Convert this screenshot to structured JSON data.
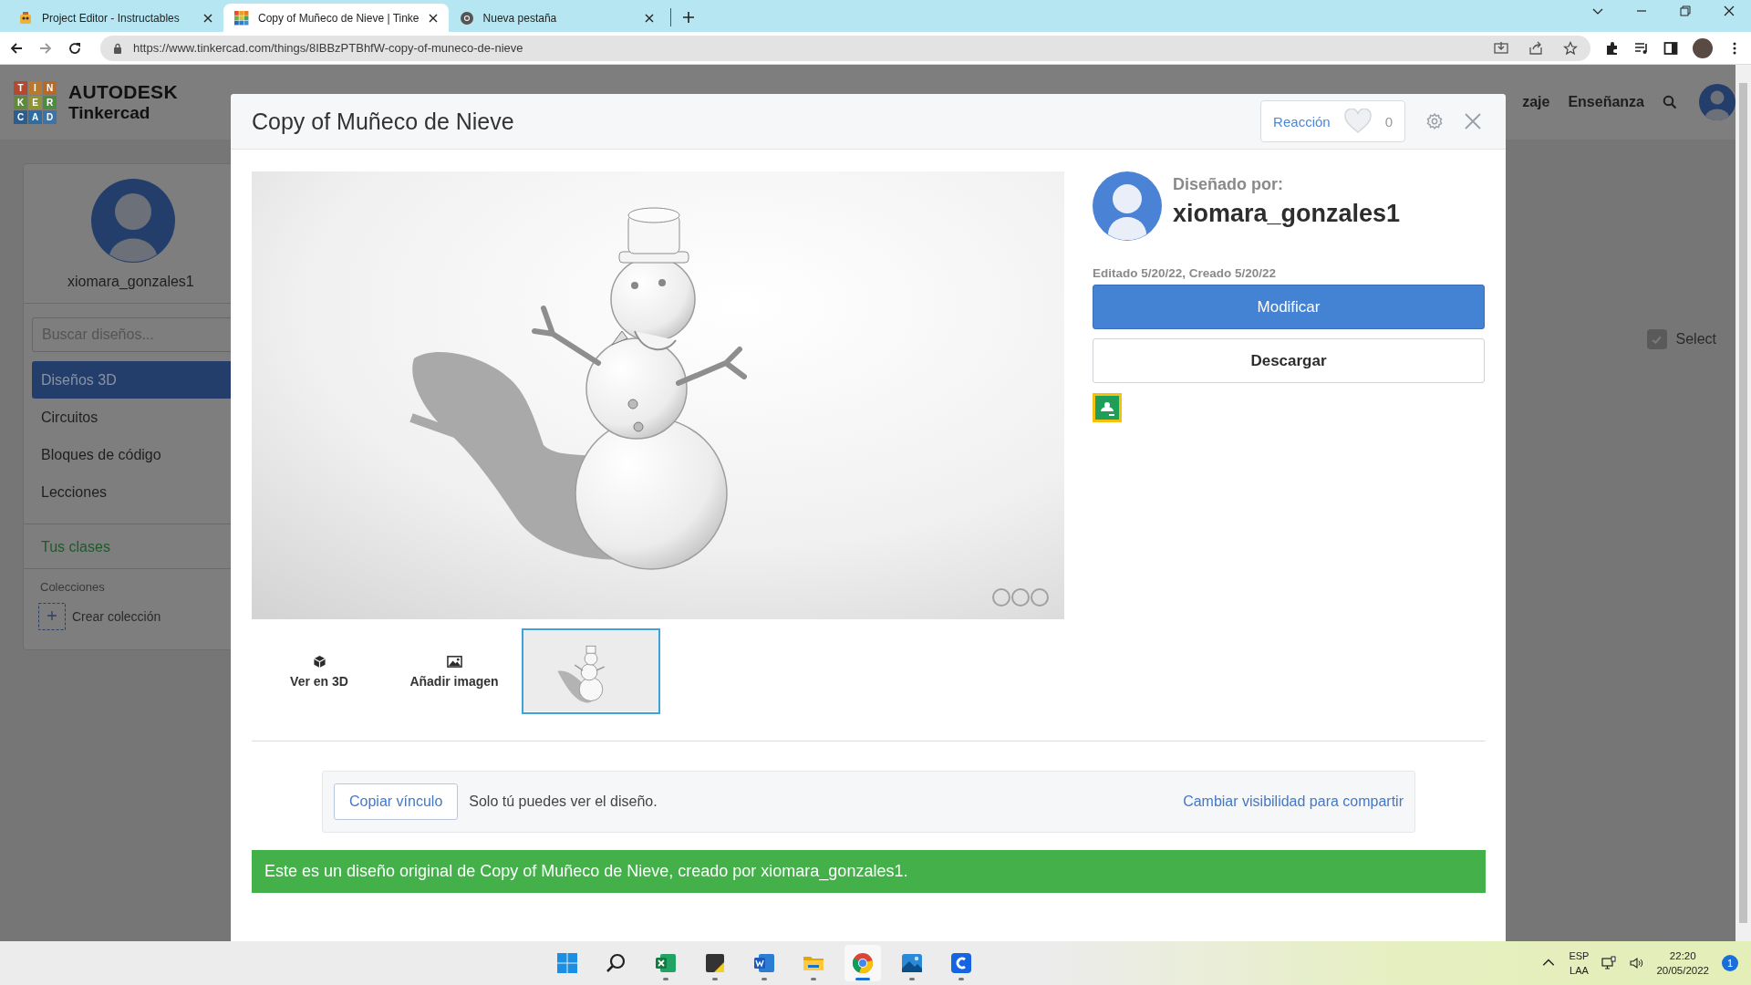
{
  "browser": {
    "tabs": [
      {
        "title": "Project Editor - Instructables",
        "kind": "robot",
        "selected": false
      },
      {
        "title": "Copy of Muñeco de Nieve | Tinke",
        "kind": "grid",
        "selected": true
      },
      {
        "title": "Nueva pestaña",
        "kind": "globe",
        "selected": false
      }
    ],
    "url": "https://www.tinkercad.com/things/8IBBzPTBhfW-copy-of-muneco-de-nieve"
  },
  "header": {
    "logo_tiles": [
      {
        "letter": "T",
        "color": "#b3492f"
      },
      {
        "letter": "I",
        "color": "#b8782e"
      },
      {
        "letter": "N",
        "color": "#b56a2a"
      },
      {
        "letter": "K",
        "color": "#5f8a3a"
      },
      {
        "letter": "E",
        "color": "#8f9433"
      },
      {
        "letter": "R",
        "color": "#4f8a43"
      },
      {
        "letter": "C",
        "color": "#2c5d8f"
      },
      {
        "letter": "A",
        "color": "#2e6da1"
      },
      {
        "letter": "D",
        "color": "#3a74a8"
      }
    ],
    "brand": "AUTODESK",
    "product": "Tinkercad",
    "nav": [
      "zaje",
      "Enseñanza"
    ]
  },
  "sidebar": {
    "username": "xiomara_gonzales1",
    "search_placeholder": "Buscar diseños...",
    "items": [
      {
        "label": "Diseños 3D",
        "selected": true
      },
      {
        "label": "Circuitos",
        "selected": false
      },
      {
        "label": "Bloques de código",
        "selected": false
      },
      {
        "label": "Lecciones",
        "selected": false
      }
    ],
    "classes": "Tus clases",
    "collections_heading": "Colecciones",
    "create_collection": "Crear colección"
  },
  "select": {
    "label": "Select",
    "checked": true
  },
  "modal": {
    "title": "Copy of Muñeco de Nieve",
    "reaction": {
      "label": "Reacción",
      "count": "0"
    },
    "designer": {
      "heading": "Diseñado por:",
      "name": "xiomara_gonzales1"
    },
    "dates": "Editado 5/20/22, Creado 5/20/22",
    "primary_button": "Modificar",
    "secondary_button": "Descargar",
    "actions": [
      {
        "label": "Ver en 3D",
        "kind": "cube"
      },
      {
        "label": "Añadir imagen",
        "kind": "image"
      }
    ],
    "thumbnail": {
      "selected": true
    },
    "share": {
      "button": "Copiar vínculo",
      "text": "Solo tú puedes ver el diseño.",
      "link": "Cambiar visibilidad para compartir"
    },
    "banner": "Este es un diseño original de Copy of Muñeco de Nieve, creado por xiomara_gonzales1."
  },
  "taskbar": {
    "apps": [
      {
        "kind": "start",
        "running": false,
        "active": false
      },
      {
        "kind": "search",
        "running": false,
        "active": false
      },
      {
        "kind": "sheet",
        "running": true,
        "active": false
      },
      {
        "kind": "note",
        "running": true,
        "active": false
      },
      {
        "kind": "doc",
        "running": true,
        "active": false
      },
      {
        "kind": "folder",
        "running": true,
        "active": false
      },
      {
        "kind": "browser",
        "running": true,
        "active": true
      },
      {
        "kind": "photos",
        "running": true,
        "active": false
      },
      {
        "kind": "capp",
        "running": true,
        "active": false
      }
    ],
    "language": [
      "ESP",
      "LAA"
    ],
    "time": "22:20",
    "date": "20/05/2022",
    "notifications": "1"
  }
}
